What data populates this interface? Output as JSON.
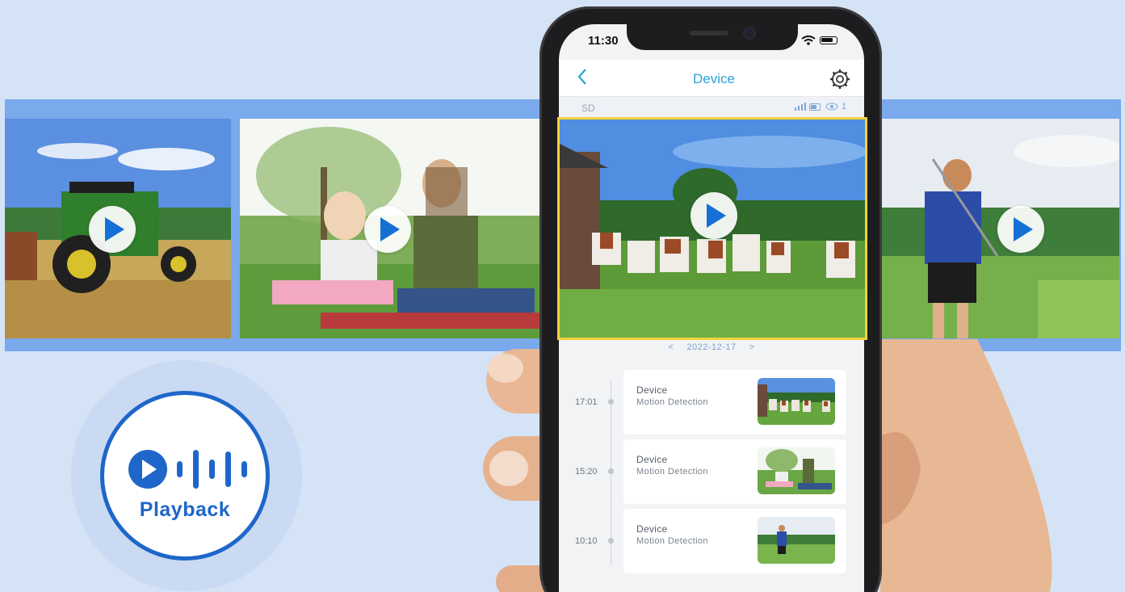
{
  "status_bar": {
    "time": "11:30"
  },
  "app_bar": {
    "title": "Device"
  },
  "sub_bar": {
    "storage_label": "SD",
    "viewer_count": "1"
  },
  "date_nav": {
    "prev": "<",
    "date": "2022-12-17",
    "next": ">"
  },
  "events": [
    {
      "time": "17:01",
      "title": "Device",
      "subtitle": "Motion Detection",
      "thumb": "cows"
    },
    {
      "time": "15:20",
      "title": "Device",
      "subtitle": "Motion Detection",
      "thumb": "mother-daughter"
    },
    {
      "time": "10:10",
      "title": "Device",
      "subtitle": "Motion Detection",
      "thumb": "golfer"
    }
  ],
  "filmstrip": [
    "tractor",
    "mother-daughter",
    "cows",
    "golfer"
  ],
  "badge": {
    "label": "Playback"
  },
  "colors": {
    "accent": "#29a3d6",
    "badge_blue": "#1e66c9",
    "band": "#7aa9ec",
    "highlight": "#f2d23c"
  }
}
